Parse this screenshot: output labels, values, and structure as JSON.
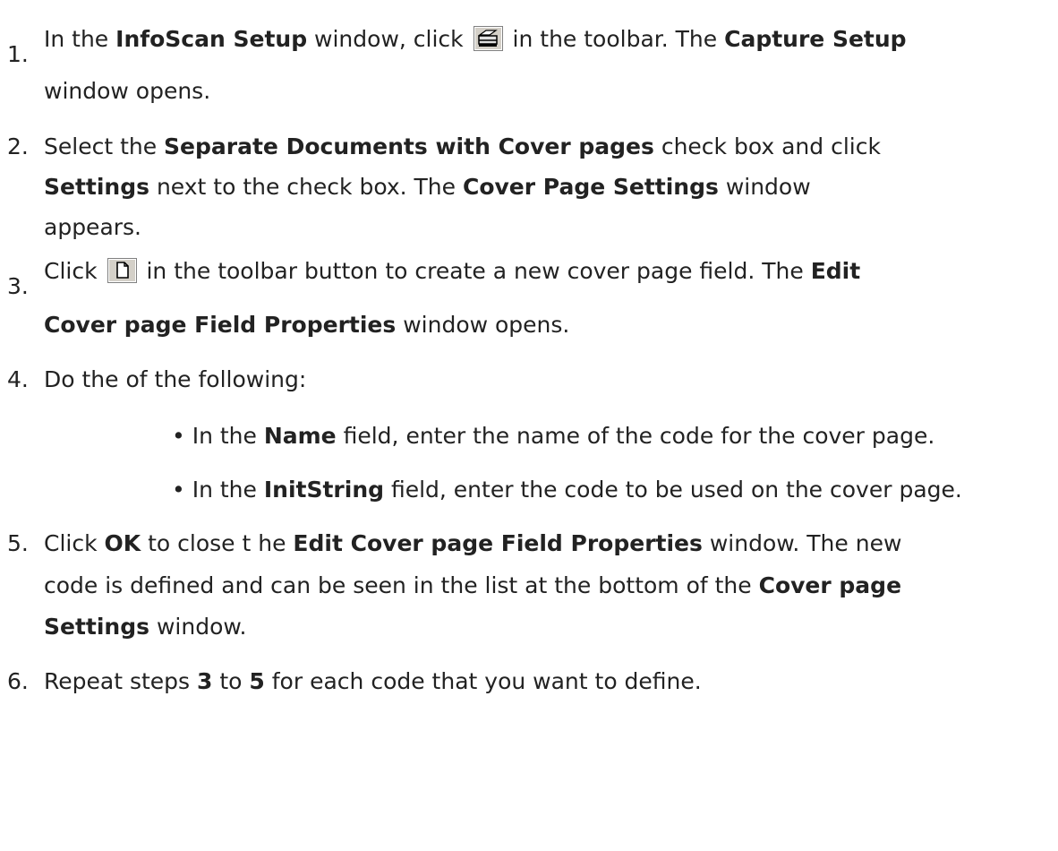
{
  "steps": [
    {
      "number": "1.",
      "lines": [
        {
          "t1": "In the ",
          "b1": "InfoScan Setup",
          "t2": " window, click ",
          "t3": " in the toolbar. The ",
          "b2": "Capture Setup"
        },
        {
          "t1": "window opens."
        }
      ]
    },
    {
      "number": "2.",
      "lines": [
        {
          "t1": "Select the ",
          "b1": "Separate Documents with Cover pages",
          "t2": " check box and click"
        },
        {
          "b1": "Settings",
          "t1": " next to the check box. The ",
          "b2": "Cover Page Settings",
          "t2": " window"
        },
        {
          "t1": "appears."
        }
      ]
    },
    {
      "number": "3.",
      "lines": [
        {
          "t1": "Click ",
          "t2": " in the toolbar button to create a new cover page field. The ",
          "b1": "Edit"
        },
        {
          "b1": "Cover page Field Properties",
          "t1": " window opens."
        }
      ]
    },
    {
      "number": "4.",
      "lines": [
        {
          "t1": "Do the of the following:"
        }
      ],
      "bullets": [
        {
          "t1": "In the ",
          "b1": "Name",
          "t2": " field, enter the name of the code for the cover page."
        },
        {
          "t1": "In the ",
          "b1": "InitString",
          "t2": " field, enter the code to be used on the cover page."
        }
      ]
    },
    {
      "number": "5.",
      "lines": [
        {
          "t1": "Click ",
          "b1": "OK",
          "t2": " to close t he ",
          "b2": "Edit Cover page Field Properties",
          "t3": " window. The new"
        },
        {
          "t1": "code is defined and can be seen in the list at the bottom of the ",
          "b1": "Cover page"
        },
        {
          "b1": "Settings",
          "t1": " window."
        }
      ]
    },
    {
      "number": "6.",
      "lines": [
        {
          "t1": "Repeat steps ",
          "b1": "3",
          "t2": " to ",
          "b3": "5",
          "t3": " for each code that you want to define."
        }
      ]
    }
  ],
  "bullet_char": "•",
  "icons": {
    "capture_setup": "scanner-icon",
    "new_field": "new-page-icon"
  }
}
